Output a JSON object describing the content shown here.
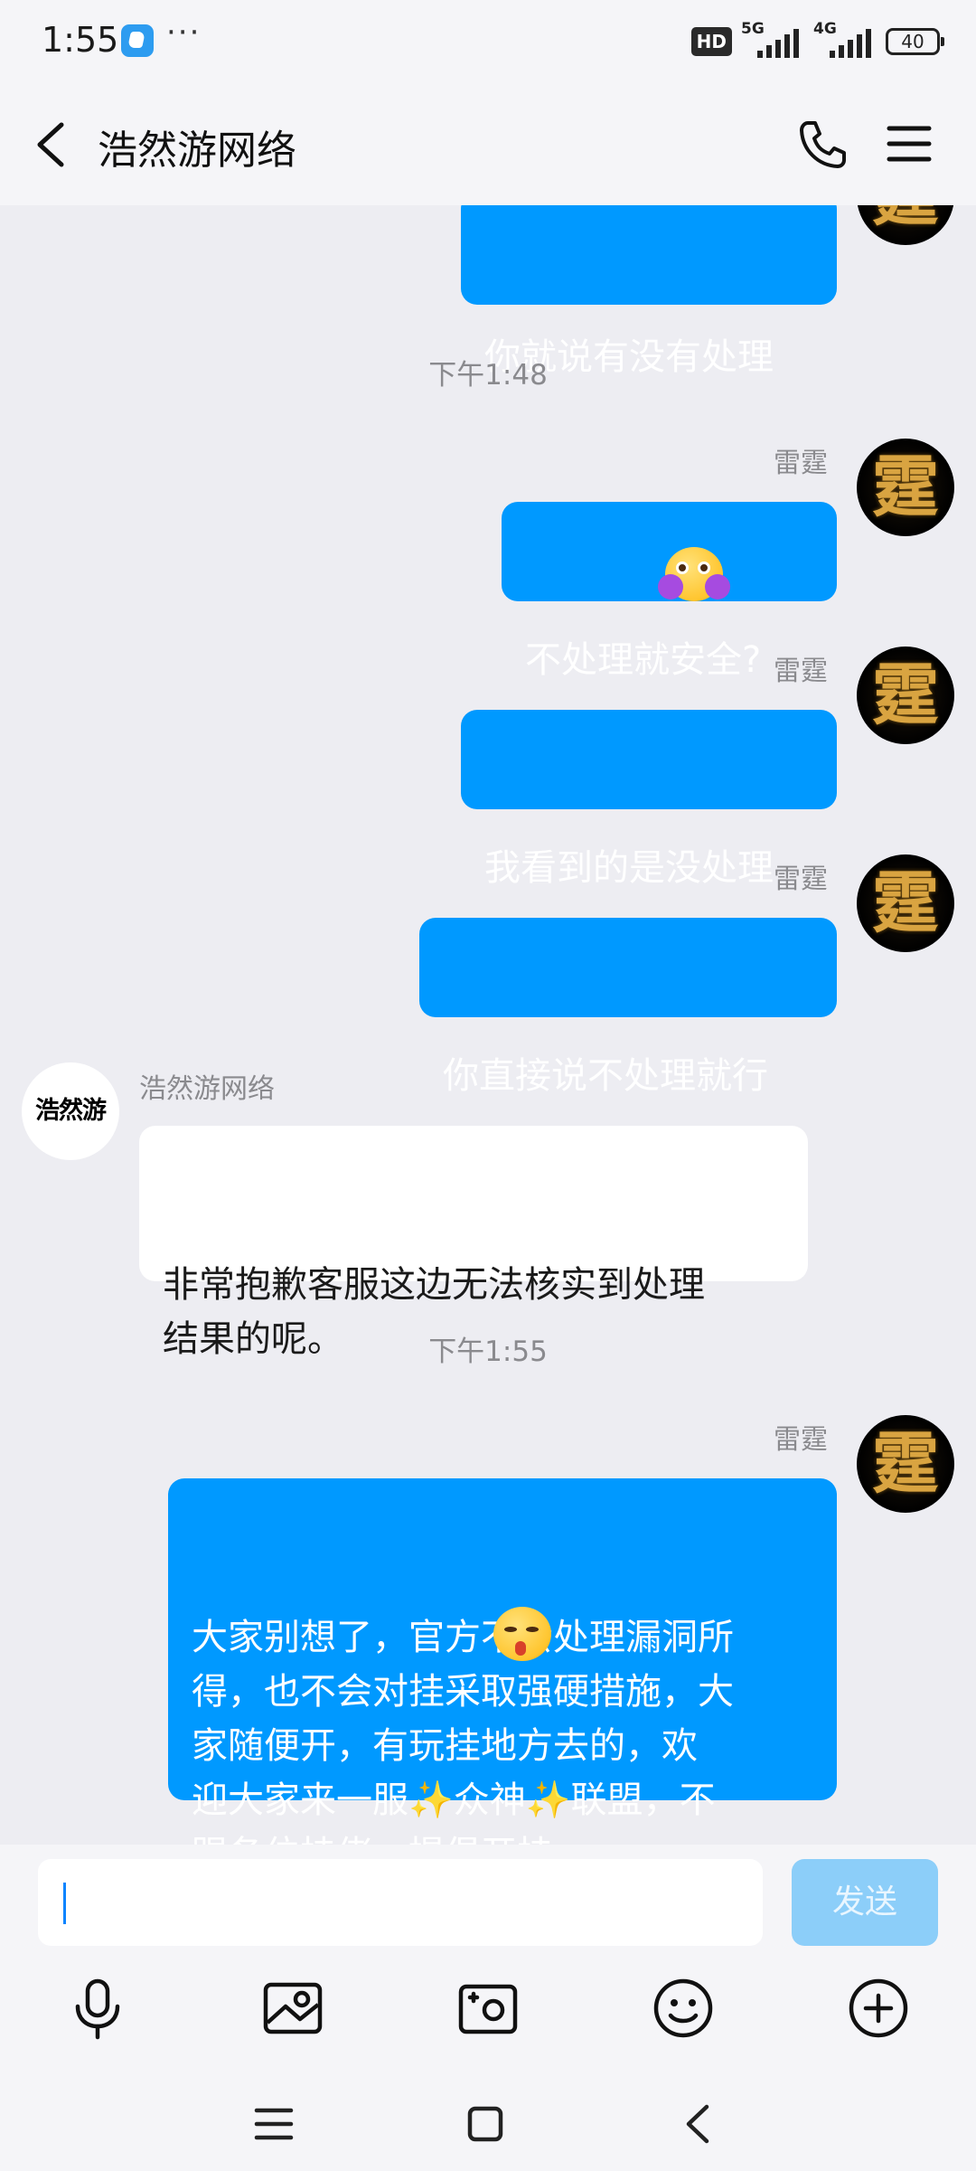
{
  "status_bar": {
    "time": "1:55",
    "more": "···",
    "hd": "HD",
    "net1": "5G",
    "net2": "4G",
    "battery": "40"
  },
  "header": {
    "title": "浩然游网络"
  },
  "chat": {
    "messages": [
      {
        "text": "你就说有没有处理"
      },
      {
        "timestamp": "下午1:48"
      },
      {
        "sender": "雷霆",
        "text": "不处理就安全?"
      },
      {
        "sender": "雷霆",
        "text": "我看到的是没处理"
      },
      {
        "sender": "雷霆",
        "text": "你直接说不处理就行"
      },
      {
        "sender": "浩然游网络",
        "text": "非常抱歉客服这边无法核实到处理\n结果的呢。"
      },
      {
        "timestamp": "下午1:55"
      },
      {
        "sender": "雷霆",
        "text": "大家别想了，官方不会处理漏洞所\n得，也不会对挂采取强硬措施，大\n家随便开，有玩挂地方去的，欢\n迎大家来一服✨众神✨联盟，不\n踢各位挂佬，提倡开挂"
      }
    ],
    "avatar_lei_glyph": "霆",
    "avatar_hao_glyph": "浩然游"
  },
  "input": {
    "value": "",
    "send_label": "发送"
  },
  "colors": {
    "accent": "#0099FF",
    "send_disabled": "#8CCEF9",
    "background": "#EDEDF2"
  },
  "icons": {
    "toolbar": [
      "microphone-icon",
      "image-icon",
      "camera-icon",
      "emoji-icon",
      "plus-icon"
    ],
    "nav": [
      "menu-icon",
      "home-icon",
      "back-icon"
    ]
  }
}
